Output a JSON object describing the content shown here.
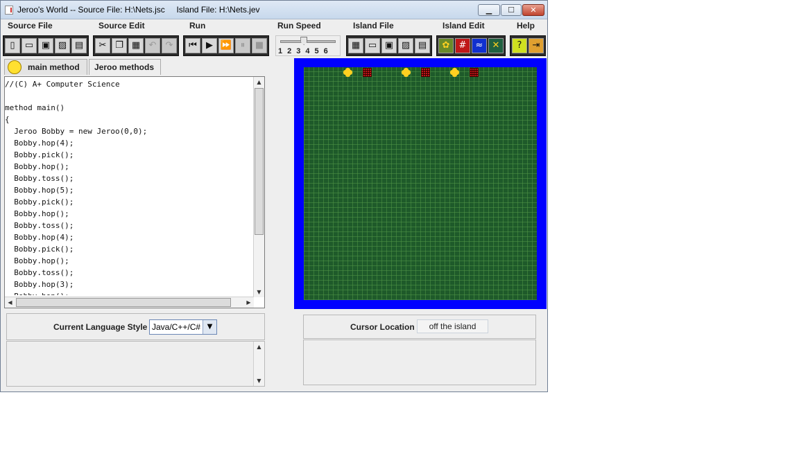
{
  "window": {
    "title": "Jeroo's World -- Source File: H:\\Nets.jsc     Island File: H:\\Nets.jev"
  },
  "menu": [
    "Source File",
    "Source Edit",
    "Run",
    "Run Speed",
    "Island File",
    "Island Edit",
    "Help"
  ],
  "toolbar": {
    "file_icons": [
      "new-file-icon",
      "open-file-icon",
      "save-icon",
      "save-as-icon",
      "print-icon"
    ],
    "edit_icons": [
      "cut-icon",
      "copy-icon",
      "paste-icon",
      "undo-icon",
      "redo-icon"
    ],
    "run_icons": [
      "reset-icon",
      "step-icon",
      "run-icon",
      "pause-icon",
      "stop-icon"
    ],
    "island_file_icons": [
      "new-island-icon",
      "open-island-icon",
      "save-island-icon",
      "save-island-as-icon",
      "print-island-icon"
    ],
    "island_edit_icons": [
      "flower-icon",
      "net-icon",
      "water-icon",
      "clear-icon"
    ],
    "help_icons": [
      "help-icon",
      "exit-icon"
    ]
  },
  "speed": {
    "labels": [
      "1",
      "2",
      "3",
      "4",
      "5",
      "6"
    ],
    "value": 3
  },
  "tabs": [
    "main method",
    "Jeroo methods"
  ],
  "code": [
    "//(C) A+ Computer Science",
    "",
    "method main()",
    "{",
    "  Jeroo Bobby = new Jeroo(0,0);",
    "  Bobby.hop(4);",
    "  Bobby.pick();",
    "  Bobby.hop();",
    "  Bobby.toss();",
    "  Bobby.hop(5);",
    "  Bobby.pick();",
    "  Bobby.hop();",
    "  Bobby.toss();",
    "  Bobby.hop(4);",
    "  Bobby.pick();",
    "  Bobby.hop();",
    "  Bobby.toss();",
    "  Bobby.hop(3);",
    "  Bobby.hop();"
  ],
  "language": {
    "label": "Current Language Style",
    "value": "Java/C++/C#"
  },
  "cursor": {
    "label": "Cursor Location",
    "value": "off the island"
  },
  "island": {
    "grid_columns": 24,
    "items": [
      {
        "type": "flower",
        "col": 4
      },
      {
        "type": "net",
        "col": 6
      },
      {
        "type": "flower",
        "col": 10
      },
      {
        "type": "net",
        "col": 12
      },
      {
        "type": "flower",
        "col": 15
      },
      {
        "type": "net",
        "col": 17
      }
    ]
  }
}
